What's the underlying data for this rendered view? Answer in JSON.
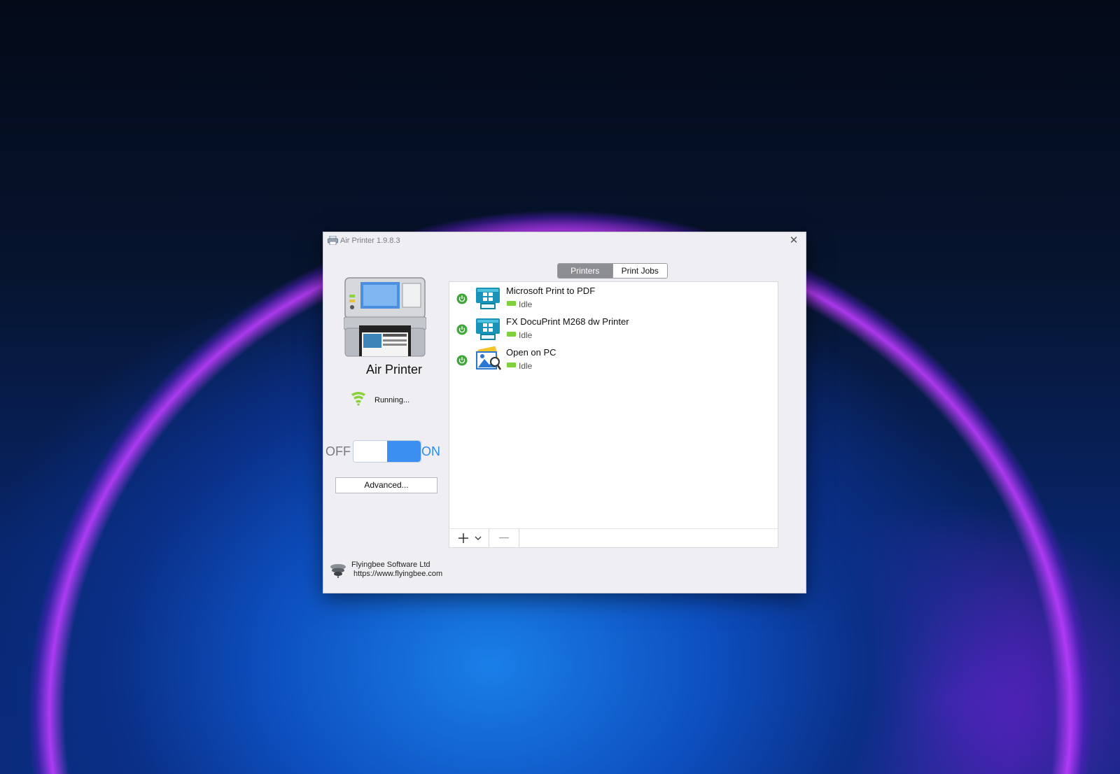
{
  "window": {
    "title": "Air Printer 1.9.8.3",
    "close_glyph": "✕"
  },
  "left_panel": {
    "app_name": "Air Printer",
    "status": "Running...",
    "toggle": {
      "off_label": "OFF",
      "on_label": "ON",
      "state": "on"
    },
    "advanced_label": "Advanced..."
  },
  "footer": {
    "company": "Flyingbee Software Ltd",
    "url": "https://www.flyingbee.com"
  },
  "tabs": [
    {
      "label": "Printers",
      "active": true
    },
    {
      "label": "Print Jobs",
      "active": false
    }
  ],
  "printers": [
    {
      "name": "Microsoft Print to PDF",
      "status": "Idle",
      "icon": "printer-icon",
      "enabled": true
    },
    {
      "name": "FX DocuPrint M268 dw Printer",
      "status": "Idle",
      "icon": "printer-icon",
      "enabled": true
    },
    {
      "name": "Open on PC",
      "status": "Idle",
      "icon": "photo-viewer-icon",
      "enabled": true
    }
  ],
  "colors": {
    "accent": "#3b8ff1",
    "status_green": "#7fd13b",
    "power_green": "#3fa63a"
  }
}
